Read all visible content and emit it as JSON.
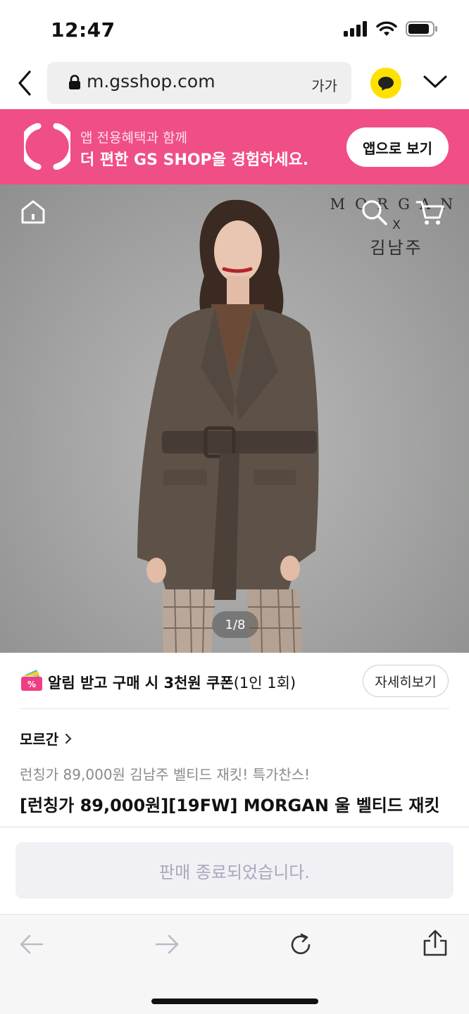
{
  "status_bar": {
    "time": "12:47"
  },
  "browser": {
    "url": "m.gsshop.com",
    "text_size_label": "가가"
  },
  "app_banner": {
    "line1": "앱 전용혜택과 함께",
    "line2": "더 편한 GS SHOP을 경험하세요.",
    "button": "앱으로 보기",
    "color": "#f04e86"
  },
  "hero": {
    "brand_top": "MORGAN",
    "brand_x": "X",
    "brand_person": "김남주",
    "pager": "1/8"
  },
  "coupon": {
    "text_bold": "알림 받고 구매 시 3천원 쿠폰",
    "text_rest": "(1인 1회)",
    "detail_button": "자세히보기"
  },
  "product": {
    "brand_link": "모르간",
    "promo": "런칭가 89,000원 김남주 벨티드 재킷! 특가찬스!",
    "title": "[런칭가 89,000원][19FW] MORGAN 울 벨티드 재킷",
    "sold_out": "판매 종료되었습니다."
  }
}
